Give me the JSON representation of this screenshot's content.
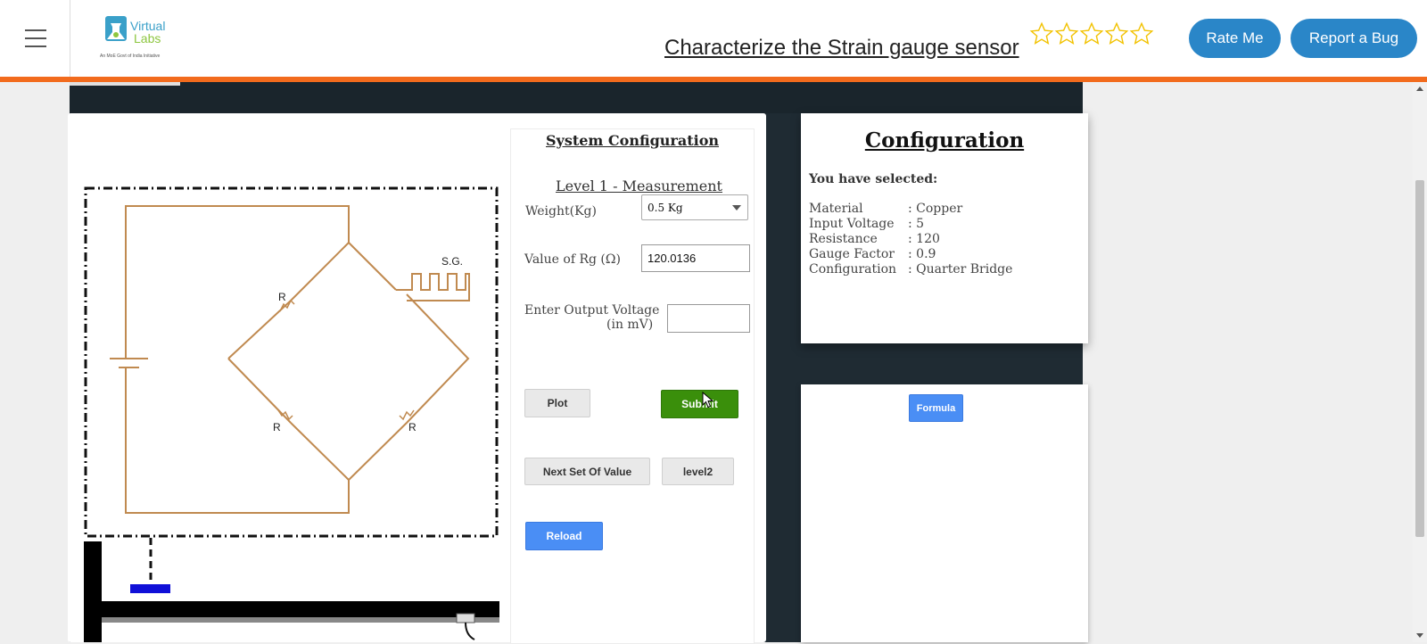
{
  "header": {
    "title": "Characterize the Strain gauge sensor",
    "logo_text_top": "Virtual",
    "logo_text_bottom": "Labs",
    "logo_tagline": "An MoE Govt of India Initiative",
    "rating": 0,
    "rating_max": 5,
    "rate_label": "Rate Me",
    "bug_label": "Report a Bug"
  },
  "circuit": {
    "labels": {
      "sg": "S.G.",
      "r_top": "R",
      "r_bottom_left": "R",
      "r_bottom_right": "R"
    }
  },
  "system_config": {
    "title": "System Configuration",
    "level": "Level 1 - Measurement",
    "weight_label": "Weight(Kg)",
    "weight_value": "0.5 Kg",
    "rg_label": "Value of Rg (Ω)",
    "rg_value": "120.0136",
    "output_label_1": "Enter Output Voltage",
    "output_label_2": "(in mV)",
    "output_value": "",
    "plot_label": "Plot",
    "submit_label": "Submit",
    "next_label": "Next Set Of Value",
    "level2_label": "level2",
    "reload_label": "Reload"
  },
  "configuration": {
    "title": "Configuration",
    "subtitle": "You have selected:",
    "rows": [
      {
        "key": "Material",
        "value": ": Copper"
      },
      {
        "key": "Input Voltage",
        "value": ": 5"
      },
      {
        "key": "Resistance",
        "value": ": 120"
      },
      {
        "key": "Gauge Factor",
        "value": ": 0.9"
      },
      {
        "key": "Configuration",
        "value": ": Quarter Bridge"
      }
    ]
  },
  "formula": {
    "button_label": "Formula"
  },
  "colors": {
    "accent_orange": "#f26b1d",
    "btn_blue": "#2a86c8",
    "submit_green": "#3a8f0b",
    "reload_blue": "#4a8ef5",
    "wire": "#c08a50"
  }
}
